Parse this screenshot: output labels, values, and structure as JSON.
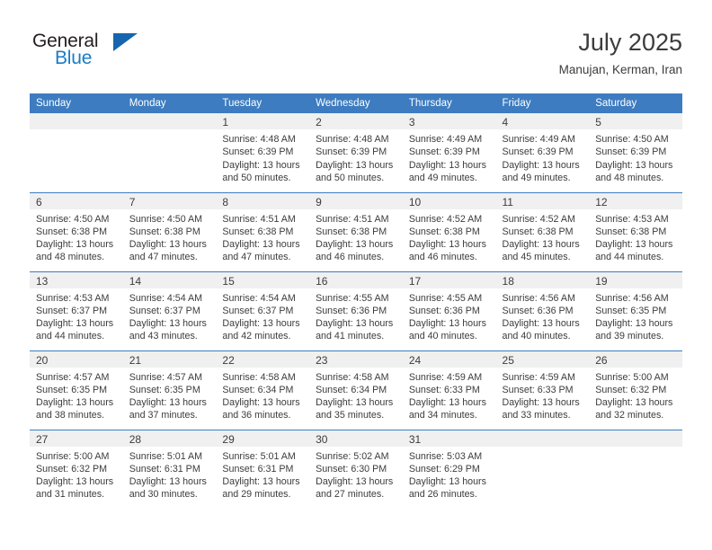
{
  "brand": {
    "name_dark": "General",
    "name_blue": "Blue",
    "accent_blue": "#1566ae",
    "text_blue": "#1a7cc4"
  },
  "header": {
    "month_title": "July 2025",
    "location": "Manujan, Kerman, Iran"
  },
  "theme": {
    "header_bg": "#3d7cc0",
    "header_text": "#ffffff",
    "daynum_band_bg": "#f0f0f0",
    "cell_bg": "#ffffff",
    "separator": "#3d7cc0",
    "body_text": "#3c3c3c"
  },
  "calendar": {
    "weekday_headers": [
      "Sunday",
      "Monday",
      "Tuesday",
      "Wednesday",
      "Thursday",
      "Friday",
      "Saturday"
    ],
    "weeks": [
      [
        {
          "day": "",
          "lines": []
        },
        {
          "day": "",
          "lines": []
        },
        {
          "day": "1",
          "lines": [
            "Sunrise: 4:48 AM",
            "Sunset: 6:39 PM",
            "Daylight: 13 hours",
            "and 50 minutes."
          ]
        },
        {
          "day": "2",
          "lines": [
            "Sunrise: 4:48 AM",
            "Sunset: 6:39 PM",
            "Daylight: 13 hours",
            "and 50 minutes."
          ]
        },
        {
          "day": "3",
          "lines": [
            "Sunrise: 4:49 AM",
            "Sunset: 6:39 PM",
            "Daylight: 13 hours",
            "and 49 minutes."
          ]
        },
        {
          "day": "4",
          "lines": [
            "Sunrise: 4:49 AM",
            "Sunset: 6:39 PM",
            "Daylight: 13 hours",
            "and 49 minutes."
          ]
        },
        {
          "day": "5",
          "lines": [
            "Sunrise: 4:50 AM",
            "Sunset: 6:39 PM",
            "Daylight: 13 hours",
            "and 48 minutes."
          ]
        }
      ],
      [
        {
          "day": "6",
          "lines": [
            "Sunrise: 4:50 AM",
            "Sunset: 6:38 PM",
            "Daylight: 13 hours",
            "and 48 minutes."
          ]
        },
        {
          "day": "7",
          "lines": [
            "Sunrise: 4:50 AM",
            "Sunset: 6:38 PM",
            "Daylight: 13 hours",
            "and 47 minutes."
          ]
        },
        {
          "day": "8",
          "lines": [
            "Sunrise: 4:51 AM",
            "Sunset: 6:38 PM",
            "Daylight: 13 hours",
            "and 47 minutes."
          ]
        },
        {
          "day": "9",
          "lines": [
            "Sunrise: 4:51 AM",
            "Sunset: 6:38 PM",
            "Daylight: 13 hours",
            "and 46 minutes."
          ]
        },
        {
          "day": "10",
          "lines": [
            "Sunrise: 4:52 AM",
            "Sunset: 6:38 PM",
            "Daylight: 13 hours",
            "and 46 minutes."
          ]
        },
        {
          "day": "11",
          "lines": [
            "Sunrise: 4:52 AM",
            "Sunset: 6:38 PM",
            "Daylight: 13 hours",
            "and 45 minutes."
          ]
        },
        {
          "day": "12",
          "lines": [
            "Sunrise: 4:53 AM",
            "Sunset: 6:38 PM",
            "Daylight: 13 hours",
            "and 44 minutes."
          ]
        }
      ],
      [
        {
          "day": "13",
          "lines": [
            "Sunrise: 4:53 AM",
            "Sunset: 6:37 PM",
            "Daylight: 13 hours",
            "and 44 minutes."
          ]
        },
        {
          "day": "14",
          "lines": [
            "Sunrise: 4:54 AM",
            "Sunset: 6:37 PM",
            "Daylight: 13 hours",
            "and 43 minutes."
          ]
        },
        {
          "day": "15",
          "lines": [
            "Sunrise: 4:54 AM",
            "Sunset: 6:37 PM",
            "Daylight: 13 hours",
            "and 42 minutes."
          ]
        },
        {
          "day": "16",
          "lines": [
            "Sunrise: 4:55 AM",
            "Sunset: 6:36 PM",
            "Daylight: 13 hours",
            "and 41 minutes."
          ]
        },
        {
          "day": "17",
          "lines": [
            "Sunrise: 4:55 AM",
            "Sunset: 6:36 PM",
            "Daylight: 13 hours",
            "and 40 minutes."
          ]
        },
        {
          "day": "18",
          "lines": [
            "Sunrise: 4:56 AM",
            "Sunset: 6:36 PM",
            "Daylight: 13 hours",
            "and 40 minutes."
          ]
        },
        {
          "day": "19",
          "lines": [
            "Sunrise: 4:56 AM",
            "Sunset: 6:35 PM",
            "Daylight: 13 hours",
            "and 39 minutes."
          ]
        }
      ],
      [
        {
          "day": "20",
          "lines": [
            "Sunrise: 4:57 AM",
            "Sunset: 6:35 PM",
            "Daylight: 13 hours",
            "and 38 minutes."
          ]
        },
        {
          "day": "21",
          "lines": [
            "Sunrise: 4:57 AM",
            "Sunset: 6:35 PM",
            "Daylight: 13 hours",
            "and 37 minutes."
          ]
        },
        {
          "day": "22",
          "lines": [
            "Sunrise: 4:58 AM",
            "Sunset: 6:34 PM",
            "Daylight: 13 hours",
            "and 36 minutes."
          ]
        },
        {
          "day": "23",
          "lines": [
            "Sunrise: 4:58 AM",
            "Sunset: 6:34 PM",
            "Daylight: 13 hours",
            "and 35 minutes."
          ]
        },
        {
          "day": "24",
          "lines": [
            "Sunrise: 4:59 AM",
            "Sunset: 6:33 PM",
            "Daylight: 13 hours",
            "and 34 minutes."
          ]
        },
        {
          "day": "25",
          "lines": [
            "Sunrise: 4:59 AM",
            "Sunset: 6:33 PM",
            "Daylight: 13 hours",
            "and 33 minutes."
          ]
        },
        {
          "day": "26",
          "lines": [
            "Sunrise: 5:00 AM",
            "Sunset: 6:32 PM",
            "Daylight: 13 hours",
            "and 32 minutes."
          ]
        }
      ],
      [
        {
          "day": "27",
          "lines": [
            "Sunrise: 5:00 AM",
            "Sunset: 6:32 PM",
            "Daylight: 13 hours",
            "and 31 minutes."
          ]
        },
        {
          "day": "28",
          "lines": [
            "Sunrise: 5:01 AM",
            "Sunset: 6:31 PM",
            "Daylight: 13 hours",
            "and 30 minutes."
          ]
        },
        {
          "day": "29",
          "lines": [
            "Sunrise: 5:01 AM",
            "Sunset: 6:31 PM",
            "Daylight: 13 hours",
            "and 29 minutes."
          ]
        },
        {
          "day": "30",
          "lines": [
            "Sunrise: 5:02 AM",
            "Sunset: 6:30 PM",
            "Daylight: 13 hours",
            "and 27 minutes."
          ]
        },
        {
          "day": "31",
          "lines": [
            "Sunrise: 5:03 AM",
            "Sunset: 6:29 PM",
            "Daylight: 13 hours",
            "and 26 minutes."
          ]
        },
        {
          "day": "",
          "lines": []
        },
        {
          "day": "",
          "lines": []
        }
      ]
    ]
  }
}
